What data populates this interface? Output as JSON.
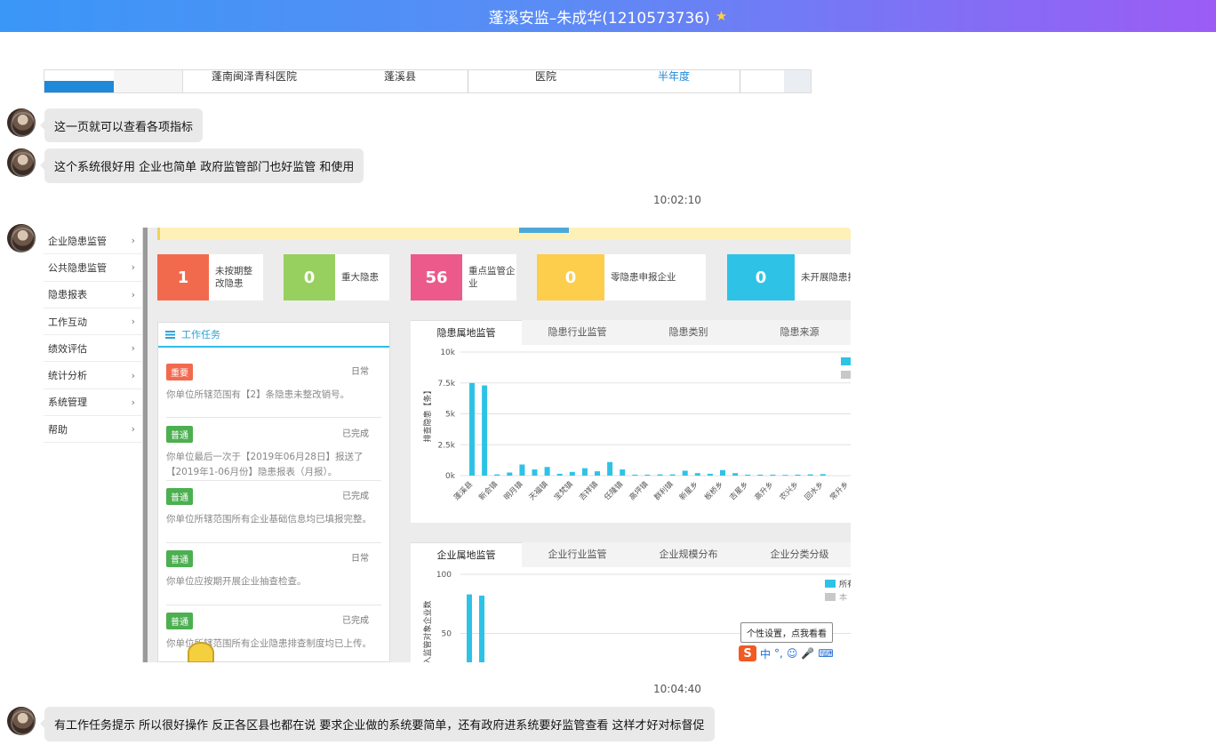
{
  "window": {
    "title": "蓬溪安监–朱成华(1210573736)",
    "star_icon": "star-icon"
  },
  "top_image": {
    "cells": [
      "蓬南闽泽青科医院",
      "蓬溪县",
      "医院",
      "半年度"
    ]
  },
  "messages": [
    {
      "text": "这一页就可以查看各项指标"
    },
    {
      "text": "这个系统很好用 企业也简单  政府监管部门也好监管 和使用"
    },
    {
      "text": "有工作任务提示 所以很好操作  反正各区县也都在说 要求企业做的系统要简单，还有政府进系统要好监管查看 这样才好对标督促"
    }
  ],
  "timestamps": [
    "10:02:10",
    "10:04:40"
  ],
  "screenshot": {
    "menu": [
      "企业隐患监管",
      "公共隐患监管",
      "隐患报表",
      "工作互动",
      "绩效评估",
      "统计分析",
      "系统管理",
      "帮助"
    ],
    "stats": [
      {
        "value": "1",
        "label": "未按期整改隐患",
        "color": "#f26a4e"
      },
      {
        "value": "0",
        "label": "重大隐患",
        "color": "#98d05f"
      },
      {
        "value": "56",
        "label": "重点监管企业",
        "color": "#ec5a8b"
      },
      {
        "value": "0",
        "label": "零隐患申报企业",
        "color": "#fdcd4c"
      },
      {
        "value": "0",
        "label": "未开展隐患排",
        "color": "#2ec3e6"
      }
    ],
    "task_panel": {
      "title": "工作任务",
      "tasks": [
        {
          "badge": "重要",
          "status": "日常",
          "desc": "你单位所辖范围有【2】条隐患未整改销号。"
        },
        {
          "badge": "普通",
          "status": "已完成",
          "desc": "你单位最后一次于【2019年06月28日】报送了【2019年1-06月份】隐患报表（月报）。"
        },
        {
          "badge": "普通",
          "status": "已完成",
          "desc": "你单位所辖范围所有企业基础信息均已填报完整。"
        },
        {
          "badge": "普通",
          "status": "日常",
          "desc": "你单位应按期开展企业抽查检查。"
        },
        {
          "badge": "普通",
          "status": "已完成",
          "desc": "你单位所辖范围所有企业隐患排查制度均已上传。"
        }
      ]
    },
    "chart1_tabs": [
      "隐患属地监管",
      "隐患行业监管",
      "隐患类别",
      "隐患来源"
    ],
    "chart2_tabs": [
      "企业属地监管",
      "企业行业监管",
      "企业规模分布",
      "企业分类分级"
    ],
    "tooltip": "个性设置，点我看看",
    "ime": {
      "lang": "中"
    }
  },
  "chart_data": [
    {
      "type": "bar",
      "ylabel": "排查隐患【条】",
      "ylim": [
        0,
        10000
      ],
      "yticks": [
        "10k",
        "7.5k",
        "5k",
        "2.5k",
        "0k"
      ],
      "categories": [
        "蓬溪县",
        "新会镇",
        "明月镇",
        "天福镇",
        "宝梵镇",
        "吉祥镇",
        "任隆镇",
        "高坪镇",
        "群利镇",
        "新星乡",
        "板桥乡",
        "吉星乡",
        "高升乡",
        "农兴乡",
        "回水乡",
        "常升乡"
      ],
      "series": [
        {
          "values": [
            7500,
            7300,
            100,
            250,
            900,
            500,
            700,
            150,
            300,
            600,
            350,
            1100,
            500,
            80,
            80,
            100,
            100,
            400,
            200,
            150,
            450,
            200,
            80,
            80,
            80,
            60,
            80,
            100,
            120
          ]
        }
      ]
    },
    {
      "type": "bar",
      "ylabel": "纳入监管对象企业数",
      "ylim": [
        0,
        100
      ],
      "yticks": [
        "100",
        "50"
      ],
      "series": [
        {
          "name": "所有",
          "values": [
            83,
            82
          ]
        },
        {
          "name": "本",
          "values": []
        }
      ]
    }
  ]
}
